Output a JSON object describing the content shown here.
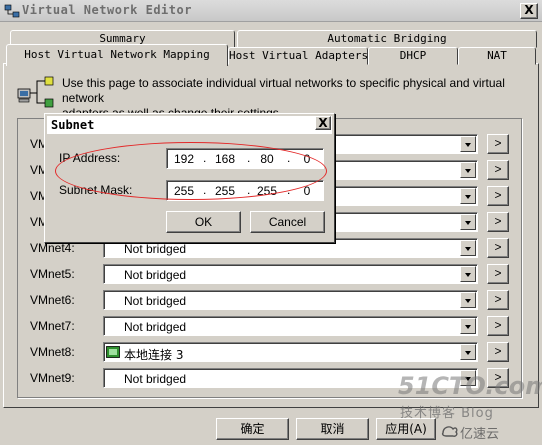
{
  "window": {
    "title": "Virtual Network Editor",
    "close": "X"
  },
  "tabs_back": [
    "Summary",
    "Automatic Bridging"
  ],
  "tabs_front": [
    "Host Virtual Network Mapping",
    "Host Virtual Adapters",
    "DHCP",
    "NAT"
  ],
  "description": [
    "Use this page to associate individual virtual networks to specific physical and virtual network",
    "adapters as well as change their settings."
  ],
  "vmnets": [
    {
      "label": "VMnet0:",
      "value": ""
    },
    {
      "label": "VMnet1:",
      "value": ""
    },
    {
      "label": "VMnet2:",
      "value": ""
    },
    {
      "label": "VMnet3:",
      "value": ""
    },
    {
      "label": "VMnet4:",
      "value": "Not bridged"
    },
    {
      "label": "VMnet5:",
      "value": "Not bridged"
    },
    {
      "label": "VMnet6:",
      "value": "Not bridged"
    },
    {
      "label": "VMnet7:",
      "value": "Not bridged"
    },
    {
      "label": "VMnet8:",
      "value": "本地连接 3"
    },
    {
      "label": "VMnet9:",
      "value": "Not bridged"
    }
  ],
  "more_label": ">",
  "buttons": {
    "ok": "确定",
    "cancel": "取消",
    "apply": "应用(A)"
  },
  "subnet_dialog": {
    "title": "Subnet",
    "close": "X",
    "ip_label": "IP Address:",
    "ip": [
      "192",
      "168",
      "80",
      "0"
    ],
    "mask_label": "Subnet Mask:",
    "mask": [
      "255",
      "255",
      "255",
      "0"
    ],
    "ok": "OK",
    "cancel": "Cancel"
  },
  "watermark": {
    "site": "51CTO.com",
    "blog": "技术博客  Blog",
    "brand": "亿速云"
  },
  "colors": {
    "annotation_ellipse": "#e32a2a",
    "dialog_title_bg": "#ffffff"
  }
}
